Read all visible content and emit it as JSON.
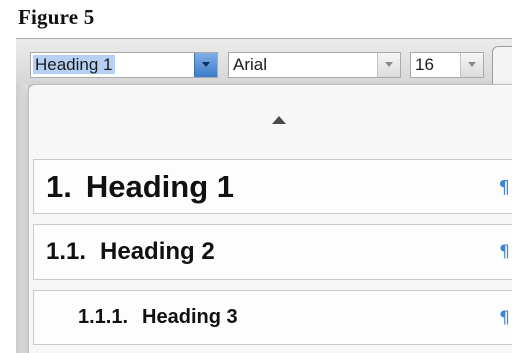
{
  "figure": {
    "caption": "Figure 5"
  },
  "toolbar": {
    "paragraph_style": {
      "value": "Heading 1"
    },
    "font_name": {
      "value": "Arial"
    },
    "font_size": {
      "value": "16"
    }
  },
  "style_dropdown": {
    "scroll_up_icon": "triangle-up",
    "items": [
      {
        "number": "1.",
        "label": "Heading 1",
        "mark": "¶"
      },
      {
        "number": "1.1.",
        "label": "Heading 2",
        "mark": "¶"
      },
      {
        "number": "1.1.1.",
        "label": "Heading 3",
        "mark": "¶"
      }
    ]
  },
  "colors": {
    "selection_highlight": "#b5d0f2",
    "active_arrow": "#3c7bc9",
    "pilcrow": "#3d86d6"
  }
}
